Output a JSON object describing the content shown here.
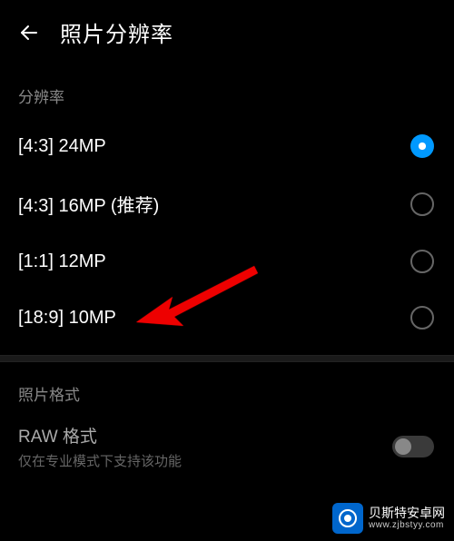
{
  "header": {
    "title": "照片分辨率"
  },
  "resolution": {
    "label": "分辨率",
    "options": [
      {
        "label": "[4:3] 24MP",
        "selected": true
      },
      {
        "label": "[4:3] 16MP (推荐)",
        "selected": false
      },
      {
        "label": "[1:1] 12MP",
        "selected": false
      },
      {
        "label": "[18:9] 10MP",
        "selected": false
      }
    ]
  },
  "format": {
    "label": "照片格式",
    "raw": {
      "title": "RAW 格式",
      "subtitle": "仅在专业模式下支持该功能",
      "enabled": false
    }
  },
  "watermark": {
    "line1": "贝斯特安卓网",
    "line2": "www.zjbstyy.com"
  }
}
